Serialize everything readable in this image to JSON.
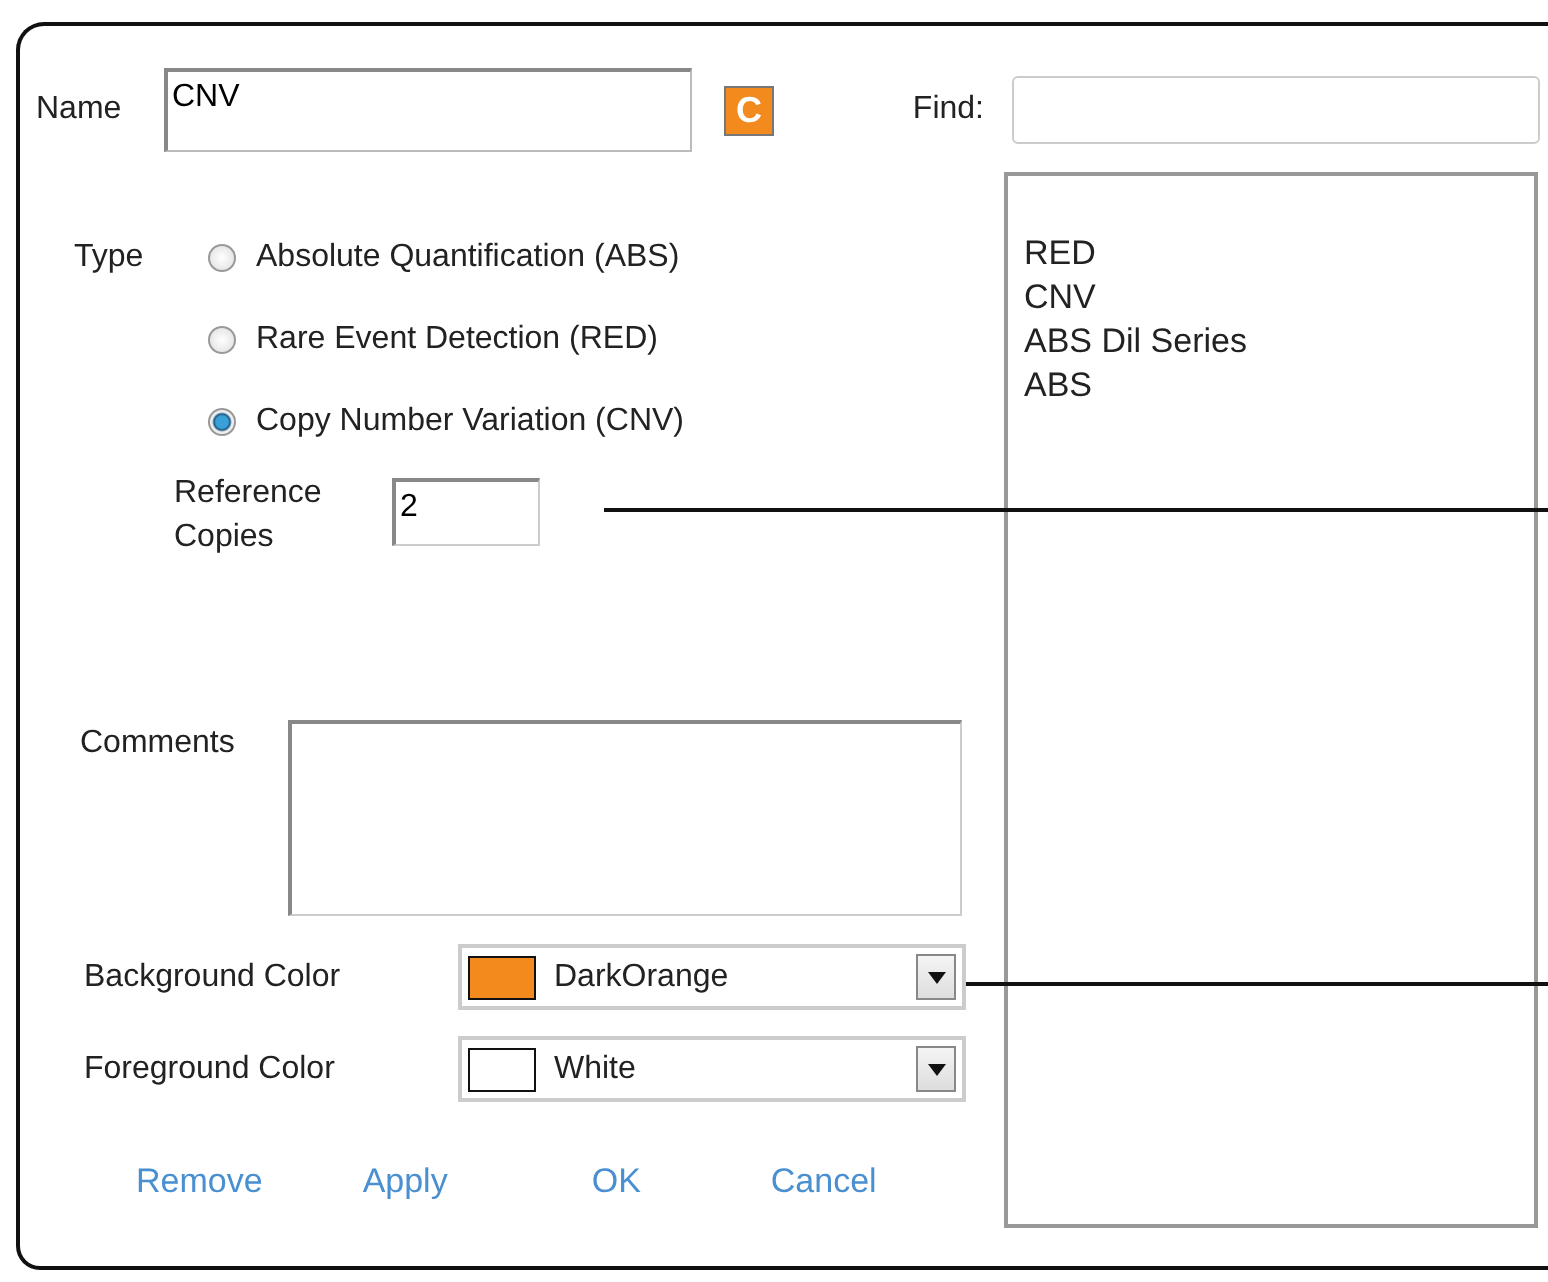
{
  "name_field": {
    "label": "Name",
    "value": "CNV"
  },
  "preview_badge": {
    "text": "C"
  },
  "find": {
    "label": "Find:"
  },
  "type": {
    "label": "Type",
    "options": [
      {
        "label": "Absolute Quantification (ABS)",
        "selected": false
      },
      {
        "label": "Rare Event Detection (RED)",
        "selected": false
      },
      {
        "label": "Copy Number Variation (CNV)",
        "selected": true
      }
    ]
  },
  "reference_copies": {
    "label": "Reference Copies",
    "value": "2"
  },
  "comments": {
    "label": "Comments"
  },
  "colors": [
    {
      "label": "Background Color",
      "value": "DarkOrange",
      "color": "#f28a1e"
    },
    {
      "label": "Foreground Color",
      "value": "White",
      "color": "#ffffff"
    }
  ],
  "buttons": [
    "Remove",
    "Apply",
    "OK",
    "Cancel"
  ],
  "list": {
    "items": [
      "RED",
      "CNV",
      "ABS Dil Series",
      "ABS"
    ]
  }
}
